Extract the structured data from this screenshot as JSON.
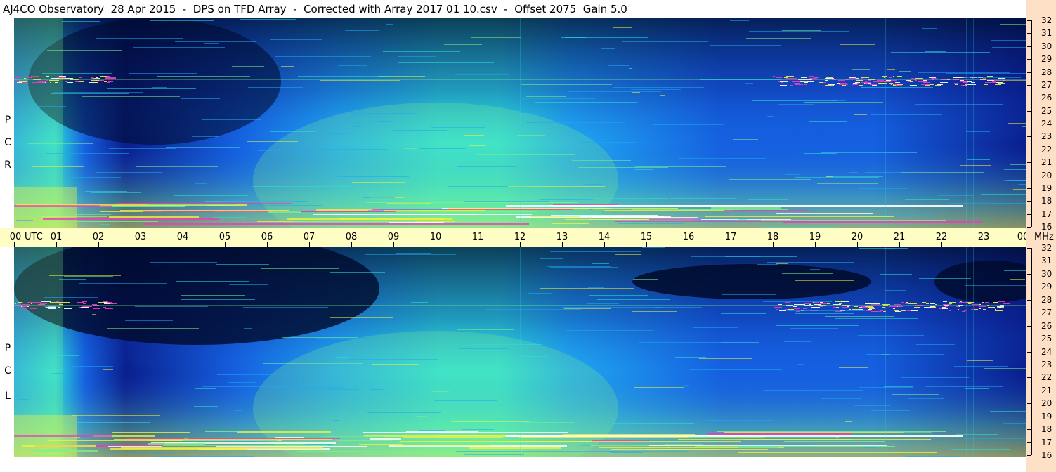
{
  "title": "AJ4CO Observatory  28 Apr 2015  -  DPS on TFD Array  -  Corrected with Array 2017 01 10.csv  -  Offset 2075  Gain 5.0",
  "panels": {
    "top": {
      "letters": [
        "R",
        "C",
        "P"
      ]
    },
    "bottom": {
      "letters": [
        "L",
        "C",
        "P"
      ]
    }
  },
  "time_axis": {
    "unit_label": "UTC",
    "ticks": [
      "00",
      "01",
      "02",
      "03",
      "04",
      "05",
      "06",
      "07",
      "08",
      "09",
      "10",
      "11",
      "12",
      "13",
      "14",
      "15",
      "16",
      "17",
      "18",
      "19",
      "20",
      "21",
      "22",
      "23",
      "00"
    ]
  },
  "freq_axis": {
    "unit_label": "MHz",
    "ticks": [
      "32",
      "31",
      "30",
      "29",
      "28",
      "27",
      "26",
      "25",
      "24",
      "23",
      "22",
      "21",
      "20",
      "19",
      "18",
      "17",
      "16"
    ]
  },
  "colors": {
    "deep": "#000a2a",
    "dark_blue": "#0a1e8c",
    "blue": "#1560e0",
    "light_blue": "#20a8f0",
    "cyan": "#2de0d8",
    "green": "#7ef08a",
    "yellow": "#f0f040",
    "magenta": "#f038c0",
    "white": "#ffffff"
  }
}
